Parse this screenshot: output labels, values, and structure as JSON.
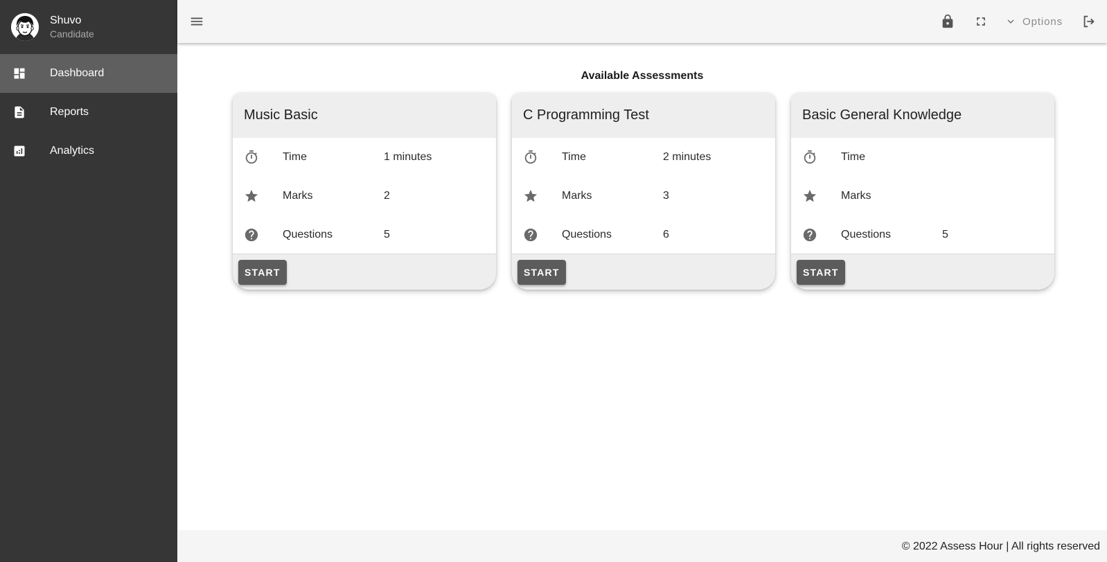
{
  "user": {
    "name": "Shuvo",
    "role": "Candidate"
  },
  "nav": {
    "items": [
      {
        "label": "Dashboard",
        "icon": "dashboard-icon",
        "active": true
      },
      {
        "label": "Reports",
        "icon": "document-icon",
        "active": false
      },
      {
        "label": "Analytics",
        "icon": "analytics-icon",
        "active": false
      }
    ]
  },
  "topbar": {
    "options_label": "Options"
  },
  "main": {
    "title": "Available Assessments",
    "cards": [
      {
        "title": "Music Basic",
        "time_label": "Time",
        "time_value": "1 minutes",
        "marks_label": "Marks",
        "marks_value": "2",
        "questions_label": "Questions",
        "questions_value": "5",
        "start_label": "START"
      },
      {
        "title": "C Programming Test",
        "time_label": "Time",
        "time_value": "2 minutes",
        "marks_label": "Marks",
        "marks_value": "3",
        "questions_label": "Questions",
        "questions_value": "6",
        "start_label": "START"
      },
      {
        "title": "Basic General Knowledge",
        "time_label": "Time",
        "time_value": "",
        "marks_label": "Marks",
        "marks_value": "",
        "questions_label": "Questions",
        "questions_value": "5",
        "start_label": "START"
      }
    ]
  },
  "footer": {
    "text": "© 2022 Assess Hour | All rights reserved"
  },
  "colors": {
    "sidebar": "#363636",
    "sidebar_active": "#5f5f5f",
    "button": "#5c5c5c",
    "card_header": "#eeeeee"
  }
}
